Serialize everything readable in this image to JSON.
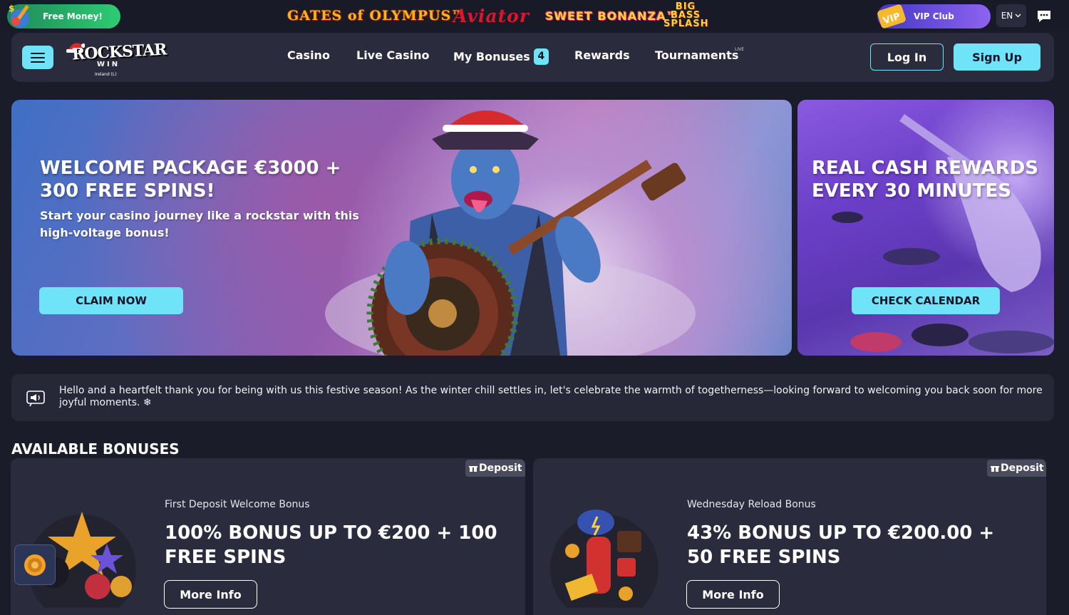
{
  "topbar": {
    "free_money_label": "Free Money!",
    "games": {
      "olympus": "GATES of OLYMPUS™",
      "aviator": "Aviator",
      "bonanza": "SWEET BONANZA™",
      "bigbass": "BIG BASS SPLASH"
    },
    "vip_badge": "VIP",
    "vip_label": "VIP Club",
    "language": "EN",
    "chat_icon": "chat-bubble-icon"
  },
  "header": {
    "logo_text": "ROCKSTAR",
    "logo_sub": "WIN",
    "logo_region": "Ireland (L)",
    "nav": {
      "casino": "Casino",
      "live_casino": "Live Casino",
      "my_bonuses": "My Bonuses",
      "bonus_count": "4",
      "rewards": "Rewards",
      "tournaments": "Tournaments",
      "live_tag": "LIVE"
    },
    "login": "Log In",
    "signup": "Sign Up"
  },
  "banners": {
    "main": {
      "title_line1": "WELCOME PACKAGE €3000 +",
      "title_line2": "300 FREE SPINS!",
      "subtitle_line1": "Start your casino journey like a rockstar with this",
      "subtitle_line2": "high-voltage bonus!",
      "cta": "CLAIM NOW"
    },
    "side": {
      "title_line1": "REAL CASH REWARDS",
      "title_line2": "EVERY 30 MINUTES",
      "cta": "CHECK CALENDAR"
    }
  },
  "announcement": {
    "text": "Hello and a heartfelt thank you for being with us this festive season! As the winter chill settles in, let's celebrate the warmth of togetherness—looking forward to welcoming you back soon for more joyful moments. ❄"
  },
  "bonuses": {
    "section_title": "AVAILABLE BONUSES",
    "cards": [
      {
        "tag": "Deposit",
        "caption": "First Deposit Welcome Bonus",
        "title": "100% BONUS UP TO €200 + 100 FREE SPINS",
        "more_info": "More Info"
      },
      {
        "tag": "Deposit",
        "caption": "Wednesday Reload Bonus",
        "title": "43% BONUS UP TO €200.00 + 50 FREE SPINS",
        "more_info": "More Info"
      }
    ]
  },
  "colors": {
    "accent": "#6fe3f7",
    "background": "#1b1c2a",
    "panel": "#2a2c3e"
  }
}
